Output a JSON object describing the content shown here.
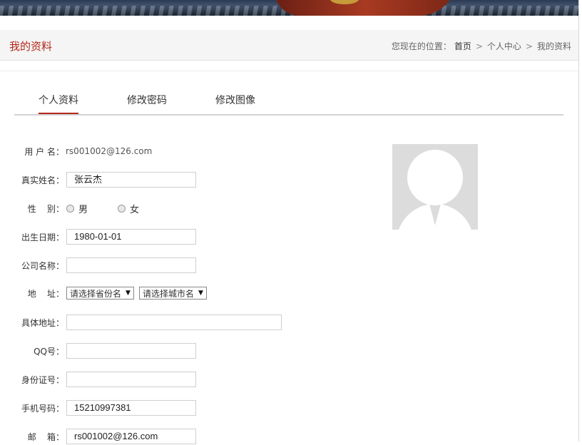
{
  "header": {
    "page_title": "我的资料",
    "breadcrumb": {
      "prefix": "您现在的位置：",
      "items": [
        "首页",
        "个人中心",
        "我的资料"
      ],
      "separator": ">"
    }
  },
  "tabs": [
    {
      "label": "个人资料",
      "active": true
    },
    {
      "label": "修改密码",
      "active": false
    },
    {
      "label": "修改图像",
      "active": false
    }
  ],
  "form": {
    "username": {
      "label": "用 户 名：",
      "value": "rs001002@126.com"
    },
    "realname": {
      "label": "真实姓名：",
      "value": "张云杰"
    },
    "gender": {
      "label": "性    别：",
      "options": [
        "男",
        "女"
      ]
    },
    "birthday": {
      "label": "出生日期：",
      "value": "1980-01-01"
    },
    "company": {
      "label": "公司名称：",
      "value": ""
    },
    "address": {
      "label": "地    址：",
      "province": "请选择省份名",
      "city": "请选择城市名"
    },
    "detail_address": {
      "label": "具体地址：",
      "value": ""
    },
    "qq": {
      "label": "QQ号：",
      "value": ""
    },
    "id_card": {
      "label": "身份证号：",
      "value": ""
    },
    "mobile": {
      "label": "手机号码：",
      "value": "15210997381"
    },
    "email": {
      "label": "邮    箱：",
      "value": "rs001002@126.com"
    }
  },
  "colors": {
    "accent": "#b3281c",
    "titlebar_bg": "#f5f5f5",
    "avatar_bg": "#dcdcdc"
  },
  "icons": {
    "avatar": "default-user-avatar-icon"
  }
}
